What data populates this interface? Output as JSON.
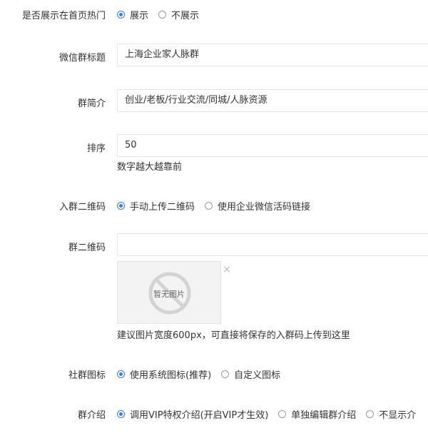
{
  "fields": {
    "show_hot": {
      "label": "是否展示在首页热门",
      "options": [
        "展示",
        "不展示"
      ],
      "selected": 0
    },
    "group_title": {
      "label": "微信群标题",
      "value": "上海企业家人脉群"
    },
    "group_intro": {
      "label": "群简介",
      "value": "创业/老板/行业交流/同城/人脉资源"
    },
    "sort": {
      "label": "排序",
      "value": "50",
      "hint": "数字越大越靠前"
    },
    "qr_mode": {
      "label": "入群二维码",
      "options": [
        "手动上传二维码",
        "使用企业微信活码链接"
      ],
      "selected": 0
    },
    "qr_code": {
      "label": "群二维码",
      "value": "",
      "placeholder_image_text": "暂无图片",
      "close": "×",
      "hint": "建议图片宽度600px，可直接将保存的入群码上传到这里"
    },
    "group_icon": {
      "label": "社群图标",
      "options": [
        "使用系统图标(推荐)",
        "自定义图标"
      ],
      "selected": 0
    },
    "group_desc": {
      "label": "群介绍",
      "options": [
        "调用VIP特权介绍(开启VIP才生效)",
        "单独编辑群介绍",
        "不显示介"
      ],
      "selected": 0
    }
  },
  "colors": {
    "accent": "#3a7bd5",
    "border": "#e3e3e3",
    "text": "#333333"
  }
}
